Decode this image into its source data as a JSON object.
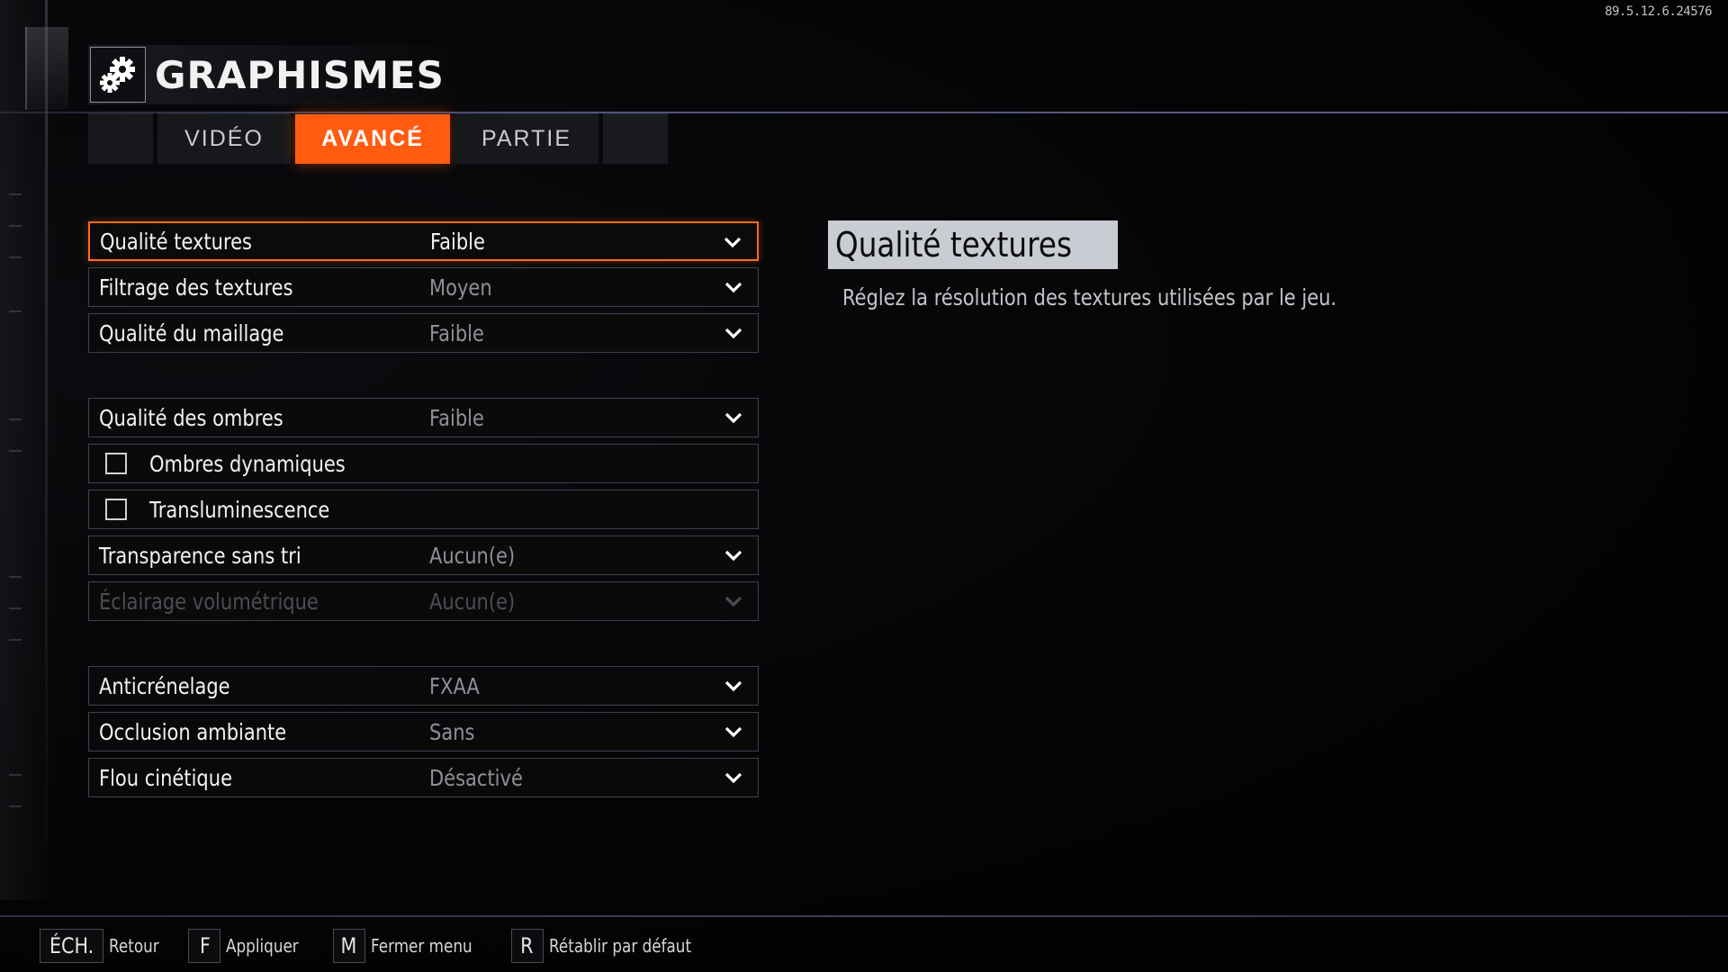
{
  "build_version": "89.5.12.6.24576",
  "header": {
    "title": "GRAPHISMES",
    "icon": "gear-icon"
  },
  "tabs": [
    {
      "label": "VIDÉO",
      "active": false
    },
    {
      "label": "AVANCÉ",
      "active": true
    },
    {
      "label": "PARTIE",
      "active": false
    }
  ],
  "settings": {
    "group1": [
      {
        "label": "Qualité textures",
        "value": "Faible"
      },
      {
        "label": "Filtrage des textures",
        "value": "Moyen"
      },
      {
        "label": "Qualité du maillage",
        "value": "Faible"
      }
    ],
    "group2": [
      {
        "label": "Qualité des ombres",
        "value": "Faible"
      },
      {
        "label": "Ombres dynamiques",
        "checked": false
      },
      {
        "label": "Transluminescence",
        "checked": false
      },
      {
        "label": "Transparence sans tri",
        "value": "Aucun(e)"
      },
      {
        "label": "Éclairage volumétrique",
        "value": "Aucun(e)",
        "disabled": true
      }
    ],
    "group3": [
      {
        "label": "Anticrénelage",
        "value": "FXAA"
      },
      {
        "label": "Occlusion ambiante",
        "value": "Sans"
      },
      {
        "label": "Flou cinétique",
        "value": "Désactivé"
      }
    ]
  },
  "description": {
    "title": "Qualité textures",
    "text": "Réglez la résolution des textures utilisées par le jeu."
  },
  "footer": [
    {
      "key": "ÉCH.",
      "label": "Retour"
    },
    {
      "key": "F",
      "label": "Appliquer"
    },
    {
      "key": "M",
      "label": "Fermer menu"
    },
    {
      "key": "R",
      "label": "Rétablir par défaut"
    }
  ],
  "colors": {
    "accent": "#ff5c12",
    "background": "#030304",
    "border": "#3e4150"
  }
}
